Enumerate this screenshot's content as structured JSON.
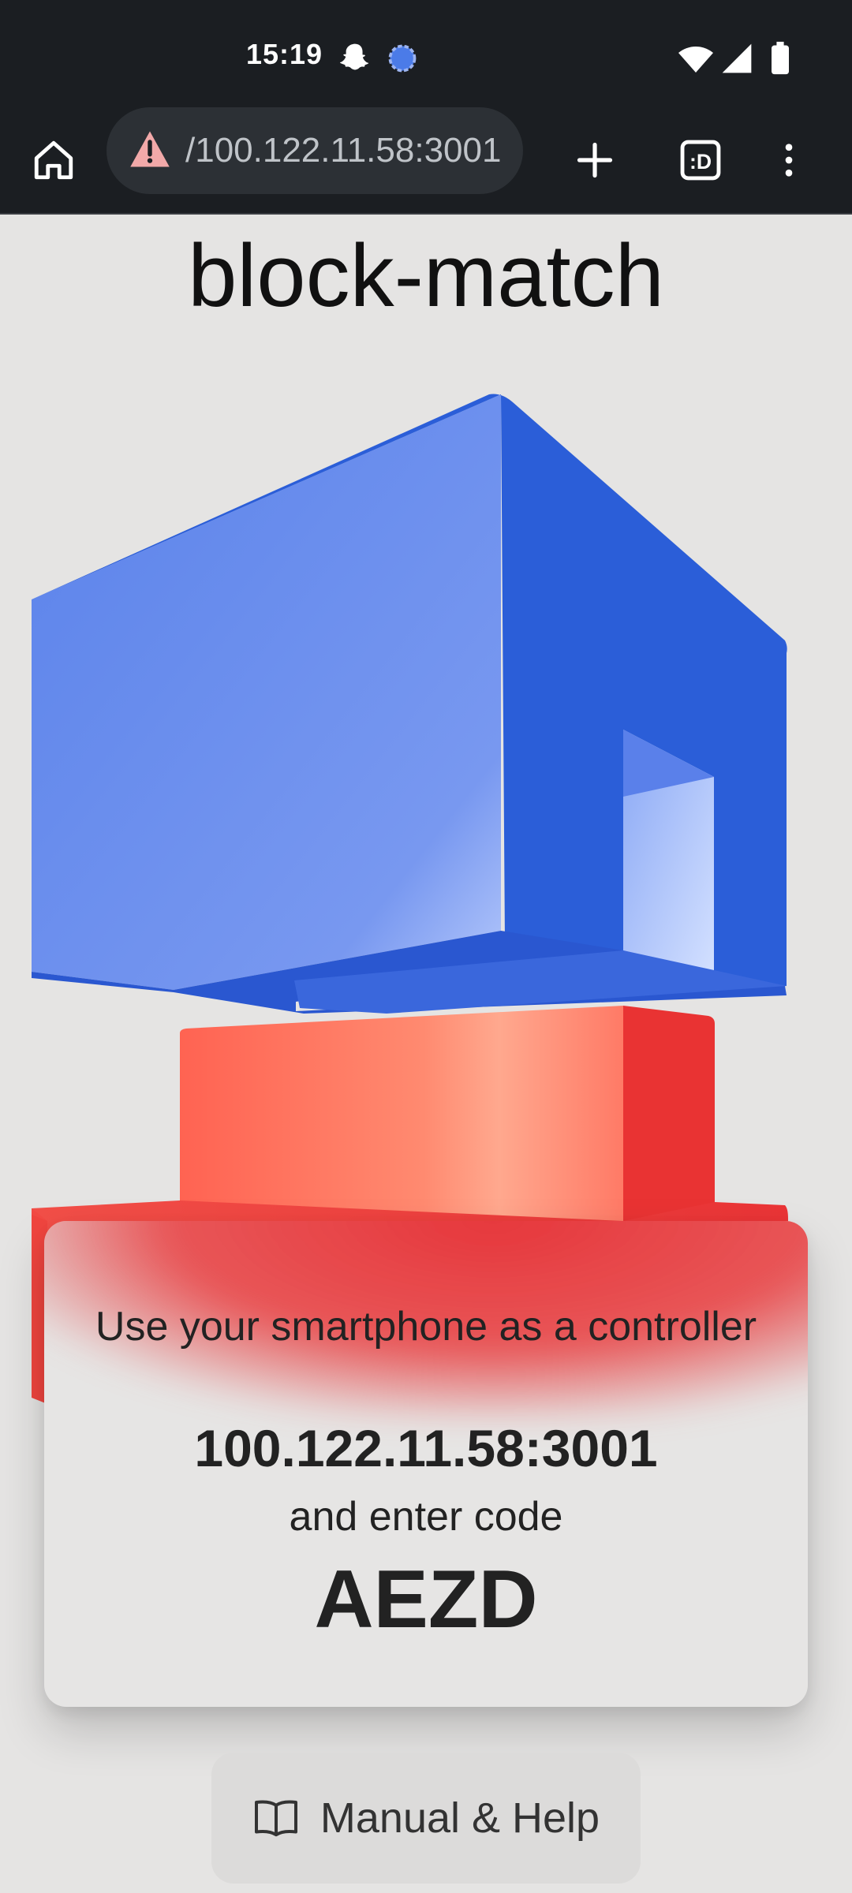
{
  "status_bar": {
    "time": "15:19"
  },
  "browser": {
    "url": "/100.122.11.58:3001",
    "tab_label": ":D"
  },
  "page": {
    "title": "block-match",
    "instruction": "Use your smartphone as a controller",
    "address": "100.122.11.58:3001",
    "enter_code_label": "and enter code",
    "code": "AEZD",
    "help_button": "Manual & Help"
  },
  "colors": {
    "blue_block": "#3f6fe6",
    "red_block": "#ee3d3d",
    "background": "#e5e4e3"
  }
}
